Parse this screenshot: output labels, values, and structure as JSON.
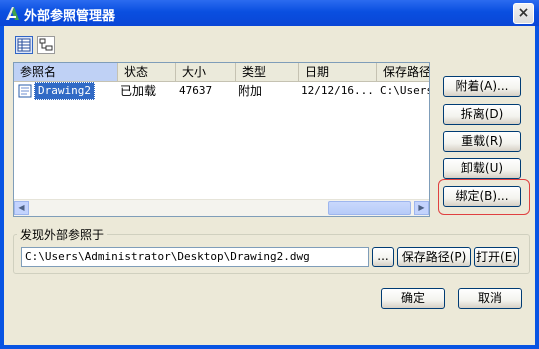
{
  "window": {
    "title": "外部参照管理器",
    "close_glyph": "×"
  },
  "list": {
    "columns": [
      "参照名",
      "状态",
      "大小",
      "类型",
      "日期",
      "保存路径"
    ],
    "rows": [
      {
        "name": "Drawing2",
        "status": "已加载",
        "size": "47637",
        "type": "附加",
        "date": "12/12/16...",
        "path": "C:\\Users"
      }
    ]
  },
  "side_buttons": {
    "attach": "附着(A)...",
    "detach": "拆离(D)",
    "reload": "重载(R)",
    "unload": "卸载(U)",
    "bind": "绑定(B)..."
  },
  "found": {
    "label": "发现外部参照于",
    "path": "C:\\Users\\Administrator\\Desktop\\Drawing2.dwg",
    "browse": "...",
    "save_path": "保存路径(P)",
    "open": "打开(E)"
  },
  "footer": {
    "ok": "确定",
    "cancel": "取消"
  },
  "icons": {
    "app": "autocad-icon",
    "list_view": "list-view-icon",
    "tree_view": "tree-view-icon",
    "dwg": "dwg-file-icon"
  }
}
